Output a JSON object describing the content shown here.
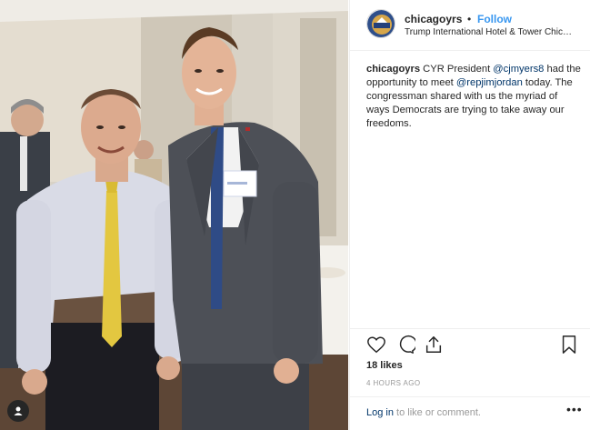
{
  "post": {
    "username": "chicagoyrs",
    "follow_separator": "•",
    "follow_label": "Follow",
    "location": "Trump International Hotel & Tower Chic…",
    "caption": {
      "author": "chicagoyrs",
      "text_1": " CYR President ",
      "mention_1": "@cjmyers8",
      "text_2": " had the opportunity to meet ",
      "mention_2": "@repjimjordan",
      "text_3": " today. The congressman shared with us the myriad of ways Democrats are trying to take away our freedoms."
    },
    "likes": "18 likes",
    "timestamp": "4 HOURS AGO",
    "login": {
      "link": "Log in",
      "suffix": " to like or comment."
    },
    "more_label": "•••"
  },
  "icons": {
    "like": "heart-icon",
    "comment": "comment-icon",
    "share": "share-icon",
    "save": "bookmark-icon",
    "user_tag": "user-tag-icon"
  },
  "colors": {
    "follow": "#3897f0",
    "link": "#003569",
    "muted": "#999999",
    "text": "#262626"
  }
}
